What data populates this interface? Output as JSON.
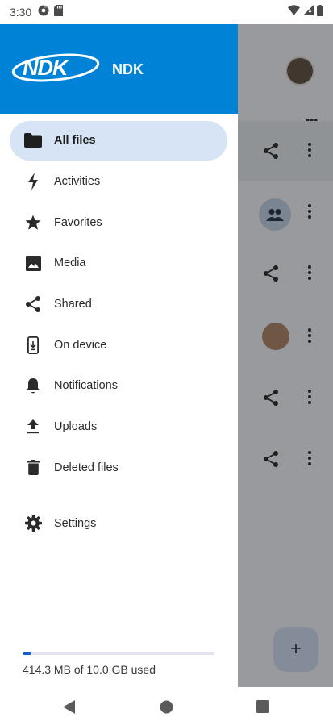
{
  "status_bar": {
    "time": "3:30",
    "left_icons": [
      "chrome-icon",
      "sd-card-icon"
    ],
    "right_icons": [
      "wifi-icon",
      "signal-icon",
      "battery-icon"
    ]
  },
  "drawer": {
    "header": {
      "brand_logo": "NDK",
      "brand_name": "NDK",
      "color": "#0083d6"
    },
    "nav_items": [
      {
        "label": "All files",
        "icon": "folder-icon",
        "active": true
      },
      {
        "label": "Activities",
        "icon": "lightning-icon",
        "active": false
      },
      {
        "label": "Favorites",
        "icon": "star-icon",
        "active": false
      },
      {
        "label": "Media",
        "icon": "image-icon",
        "active": false
      },
      {
        "label": "Shared",
        "icon": "share-icon",
        "active": false
      },
      {
        "label": "On device",
        "icon": "phone-download-icon",
        "active": false
      },
      {
        "label": "Notifications",
        "icon": "bell-icon",
        "active": false
      },
      {
        "label": "Uploads",
        "icon": "upload-icon",
        "active": false
      },
      {
        "label": "Deleted files",
        "icon": "trash-icon",
        "active": false
      }
    ],
    "settings": {
      "label": "Settings",
      "icon": "gear-icon"
    },
    "storage": {
      "used_text": "414.3 MB of 10.0 GB used",
      "fraction_used": 0.0414
    }
  },
  "colors": {
    "accent": "#0f63c8",
    "active_pill": "#d6e4f5"
  },
  "background_app": {
    "fab_label": "+"
  },
  "system_nav": [
    "back-icon",
    "home-icon",
    "recents-icon"
  ]
}
